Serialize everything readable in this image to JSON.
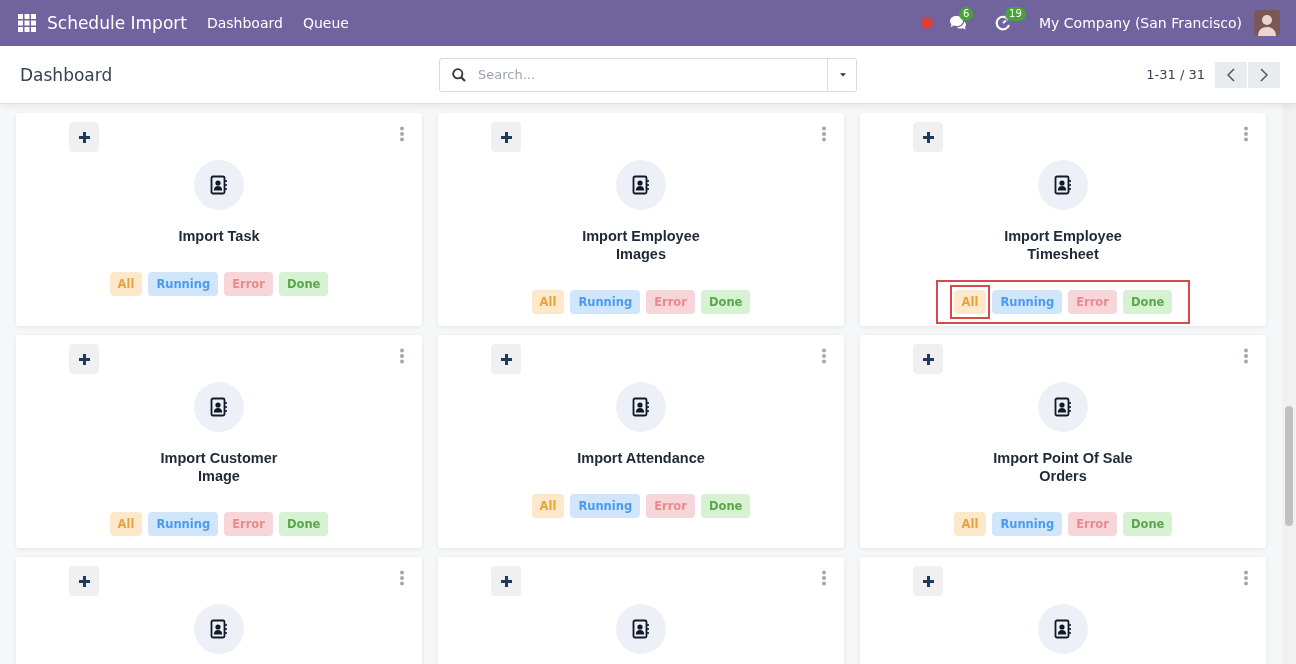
{
  "navbar": {
    "app_title": "Schedule Import",
    "menus": [
      {
        "label": "Dashboard"
      },
      {
        "label": "Queue"
      }
    ],
    "messages_count": "6",
    "activities_count": "19",
    "company": "My Company (San Francisco)"
  },
  "control_panel": {
    "title": "Dashboard",
    "search": {
      "placeholder": "Search..."
    },
    "pager": "1-31 / 31"
  },
  "cards": [
    {
      "kind": "full",
      "title": "Import Task",
      "highlighted": false,
      "filters": [
        {
          "kind": "all",
          "label": "All",
          "highlighted": false
        },
        {
          "kind": "running",
          "label": "Running",
          "highlighted": false
        },
        {
          "kind": "error",
          "label": "Error",
          "highlighted": false
        },
        {
          "kind": "done",
          "label": "Done",
          "highlighted": false
        }
      ]
    },
    {
      "kind": "full",
      "title": "Import Employee Images",
      "highlighted": false,
      "filters": [
        {
          "kind": "all",
          "label": "All",
          "highlighted": false
        },
        {
          "kind": "running",
          "label": "Running",
          "highlighted": false
        },
        {
          "kind": "error",
          "label": "Error",
          "highlighted": false
        },
        {
          "kind": "done",
          "label": "Done",
          "highlighted": false
        }
      ]
    },
    {
      "kind": "full",
      "title": "Import Employee Timesheet",
      "highlighted": true,
      "filters": [
        {
          "kind": "all",
          "label": "All",
          "highlighted": true
        },
        {
          "kind": "running",
          "label": "Running",
          "highlighted": false
        },
        {
          "kind": "error",
          "label": "Error",
          "highlighted": false
        },
        {
          "kind": "done",
          "label": "Done",
          "highlighted": false
        }
      ]
    },
    {
      "kind": "full",
      "title": "Import Customer Image",
      "highlighted": false,
      "filters": [
        {
          "kind": "all",
          "label": "All",
          "highlighted": false
        },
        {
          "kind": "running",
          "label": "Running",
          "highlighted": false
        },
        {
          "kind": "error",
          "label": "Error",
          "highlighted": false
        },
        {
          "kind": "done",
          "label": "Done",
          "highlighted": false
        }
      ]
    },
    {
      "kind": "full",
      "title": "Import Attendance",
      "highlighted": false,
      "filters": [
        {
          "kind": "all",
          "label": "All",
          "highlighted": false
        },
        {
          "kind": "running",
          "label": "Running",
          "highlighted": false
        },
        {
          "kind": "error",
          "label": "Error",
          "highlighted": false
        },
        {
          "kind": "done",
          "label": "Done",
          "highlighted": false
        }
      ]
    },
    {
      "kind": "full",
      "title": "Import Point Of Sale Orders",
      "highlighted": false,
      "filters": [
        {
          "kind": "all",
          "label": "All",
          "highlighted": false
        },
        {
          "kind": "running",
          "label": "Running",
          "highlighted": false
        },
        {
          "kind": "error",
          "label": "Error",
          "highlighted": false
        },
        {
          "kind": "done",
          "label": "Done",
          "highlighted": false
        }
      ]
    },
    {
      "kind": "cut_off"
    },
    {
      "kind": "cut_off"
    },
    {
      "kind": "cut_off"
    }
  ]
}
